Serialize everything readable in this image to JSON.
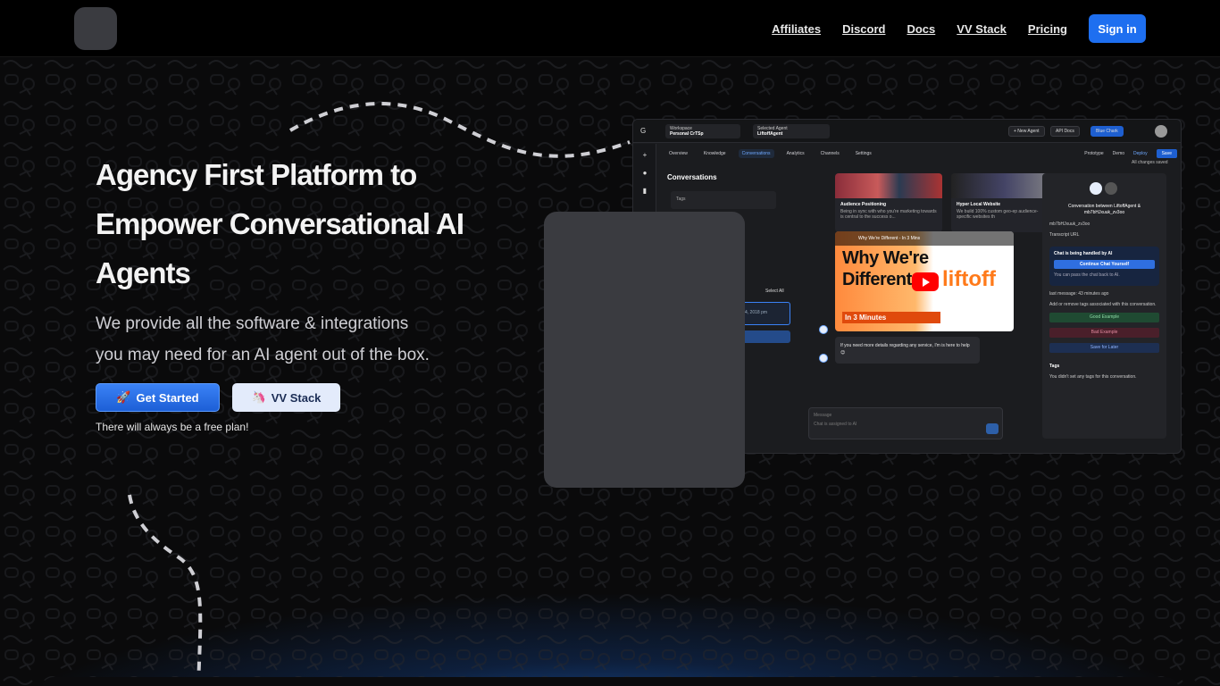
{
  "nav": {
    "links": [
      "Affiliates",
      "Discord",
      "Docs",
      "VV Stack",
      "Pricing"
    ],
    "signin_label": "Sign in"
  },
  "hero": {
    "title_line1": "Agency First Platform to",
    "title_line2": "Empower Conversational AI",
    "title_line3": "Agents",
    "subtitle_line1": "We provide all the software & integrations",
    "subtitle_line2": "you may need for an AI agent out of the box.",
    "get_started_label": "Get Started",
    "vv_stack_label": "VV Stack",
    "free_note": "There will always be a free plan!"
  },
  "app": {
    "workspace_label": "Workspace",
    "workspace_name": "Personal CrTSp",
    "agent_label": "Selected Agent",
    "agent_name": "LiftoffAgent",
    "new_agent": "+ New Agent",
    "api_docs": "API Docs",
    "status_pill": "Blue Chark",
    "tabs": [
      "Overview",
      "Knowledge",
      "Conversations",
      "Analytics",
      "Channels",
      "Settings"
    ],
    "prototype": "Prototype",
    "demo": "Demo",
    "deploy": "Deploy",
    "save": "Save",
    "saved_note": "All changes saved",
    "conversations_title": "Conversations",
    "tags_placeholder": "Tags",
    "select_all": "Select All",
    "conv_time": "4, 2018 pm",
    "card1_title": "Audience Positioning",
    "card1_text": "Being in sync with who you're marketing towards is central to the success o...",
    "card2_title": "Hyper Local Website",
    "card2_text": "We build 100% custom geo-ep audience-specific websites th",
    "video_bar": "Why We're Different - In 3 Mins",
    "video_headline": "Why We're Different",
    "video_sub": "In 3 Minutes",
    "video_brand": "liftoff",
    "bubble_text": "If you need more details regarding any service, I'm is here to help 😊",
    "message_label": "Message",
    "message_placeholder": "Chat is assigned to AI",
    "rp_title": "Conversation between LiftoffAgent & mb7bHJxuuk_zv3oo",
    "rp_id": "mb7bHJxuuk_zv3oo",
    "rp_transcript": "Transcript URL",
    "handled_title": "Chat is being handled by AI",
    "continue_btn": "Continue Chat Yourself",
    "handled_note": "You can pass the chat back to AI.",
    "last_message": "last message: 43 minutes ago",
    "tags_hint": "Add or remove tags associated with this conversation.",
    "good_example": "Good Example",
    "bad_example": "Bad Example",
    "save_later": "Save for Later",
    "tags_heading": "Tags",
    "no_tags": "You didn't set any tags for this conversation."
  },
  "colors": {
    "accent": "#1e6ff0",
    "background": "#0a0a0b",
    "placeholder": "#3a3b40"
  },
  "icons": {
    "rocket": "🚀",
    "vv_stack": "🦄"
  }
}
